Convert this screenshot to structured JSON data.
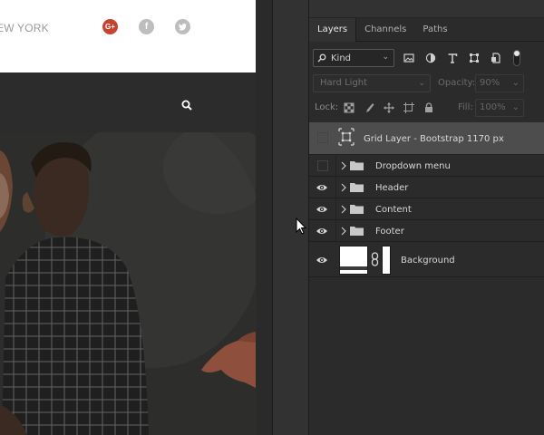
{
  "canvas": {
    "site_city": "EW YORK",
    "social": {
      "google": "G+",
      "facebook": "f",
      "twitter": "t"
    }
  },
  "layers_panel": {
    "tabs": [
      {
        "label": "Layers",
        "active": true
      },
      {
        "label": "Channels",
        "active": false
      },
      {
        "label": "Paths",
        "active": false
      }
    ],
    "filter": {
      "kind_label": "Kind",
      "filter_icons": [
        "image-filter-icon",
        "adjustment-filter-icon",
        "type-filter-icon",
        "shape-filter-icon",
        "smart-object-filter-icon",
        "filter-toggle-icon"
      ]
    },
    "blend_mode": "Hard Light",
    "opacity_label": "Opacity:",
    "opacity_value": "90%",
    "lock_label": "Lock:",
    "lock_icons": [
      "lock-transparent-icon",
      "lock-image-icon",
      "lock-position-icon",
      "lock-artboard-icon",
      "lock-all-icon"
    ],
    "fill_label": "Fill:",
    "fill_value": "100%",
    "layers": [
      {
        "name": "Grid Layer - Bootstrap 1170 px",
        "type": "smart-object",
        "visible": false,
        "selected": true
      },
      {
        "name": "Dropdown menu",
        "type": "group",
        "visible": false,
        "selected": false
      },
      {
        "name": "Header",
        "type": "group",
        "visible": true,
        "selected": false
      },
      {
        "name": "Content",
        "type": "group",
        "visible": true,
        "selected": false
      },
      {
        "name": "Footer",
        "type": "group",
        "visible": true,
        "selected": false
      },
      {
        "name": "Background",
        "type": "pixel-with-mask",
        "visible": true,
        "selected": false
      }
    ]
  },
  "colors": {
    "panel_bg": "#2b2b2b",
    "selected_row": "#4d4d4d",
    "google_red": "#c6442f"
  }
}
